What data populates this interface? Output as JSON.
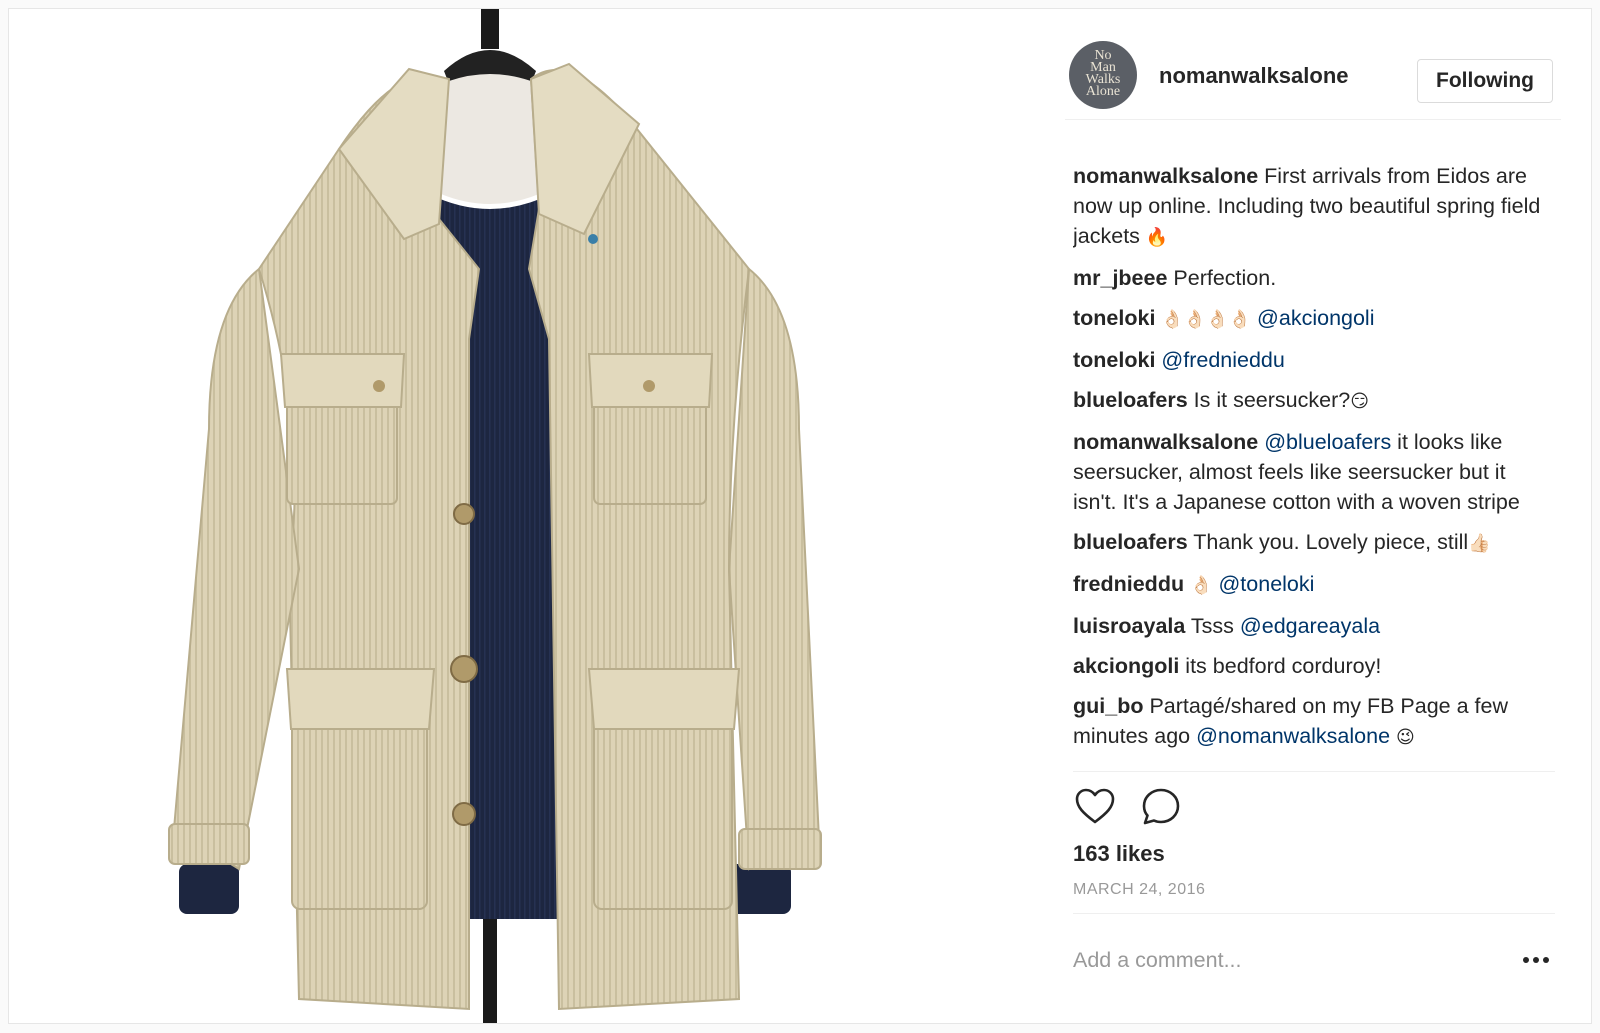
{
  "post": {
    "username": "nomanwalksalone",
    "follow_label": "Following",
    "avatar_logo_lines": [
      "No",
      "Man",
      "Walks",
      "Alone"
    ]
  },
  "comments": [
    {
      "user": "nomanwalksalone",
      "parts": [
        {
          "t": "text",
          "v": " First arrivals from Eidos are now up online. Including two beautiful spring field jackets "
        },
        {
          "t": "emoji",
          "v": "🔥"
        }
      ]
    },
    {
      "user": "mr_jbeee",
      "parts": [
        {
          "t": "text",
          "v": " Perfection."
        }
      ]
    },
    {
      "user": "toneloki",
      "parts": [
        {
          "t": "text",
          "v": " "
        },
        {
          "t": "emoji",
          "v": "👌🏻👌🏻👌🏻👌🏻"
        },
        {
          "t": "text",
          "v": " "
        },
        {
          "t": "mention",
          "v": "@akciongoli"
        }
      ]
    },
    {
      "user": "toneloki",
      "parts": [
        {
          "t": "text",
          "v": " "
        },
        {
          "t": "mention",
          "v": "@frednieddu"
        }
      ]
    },
    {
      "user": "blueloafers",
      "parts": [
        {
          "t": "text",
          "v": " Is it seersucker?"
        },
        {
          "t": "emoji",
          "v": "😏"
        }
      ]
    },
    {
      "user": "nomanwalksalone",
      "parts": [
        {
          "t": "text",
          "v": " "
        },
        {
          "t": "mention",
          "v": "@blueloafers"
        },
        {
          "t": "text",
          "v": " it looks like seersucker, almost feels like seersucker but it isn't. It's a Japanese cotton with a woven stripe"
        }
      ]
    },
    {
      "user": "blueloafers",
      "parts": [
        {
          "t": "text",
          "v": " Thank you. Lovely piece, still"
        },
        {
          "t": "emoji",
          "v": "👍🏻"
        }
      ]
    },
    {
      "user": "frednieddu",
      "parts": [
        {
          "t": "text",
          "v": " "
        },
        {
          "t": "emoji",
          "v": "👌🏻"
        },
        {
          "t": "text",
          "v": " "
        },
        {
          "t": "mention",
          "v": "@toneloki"
        }
      ]
    },
    {
      "user": "luisroayala",
      "parts": [
        {
          "t": "text",
          "v": " Tsss "
        },
        {
          "t": "mention",
          "v": "@edgareayala"
        }
      ]
    },
    {
      "user": "akciongoli",
      "parts": [
        {
          "t": "text",
          "v": " its bedford corduroy!"
        }
      ]
    },
    {
      "user": "gui_bo",
      "parts": [
        {
          "t": "text",
          "v": " Partagé/shared on my FB Page a few minutes ago "
        },
        {
          "t": "mention",
          "v": "@nomanwalksalone"
        },
        {
          "t": "text",
          "v": " "
        },
        {
          "t": "emoji",
          "v": "😉"
        }
      ]
    }
  ],
  "actions": {
    "like_icon": "heart-icon",
    "comment_icon": "speech-bubble-icon",
    "more_icon": "ellipsis-icon"
  },
  "likes_text": "163 likes",
  "date_text": "MARCH 24, 2016",
  "add_comment": {
    "placeholder": "Add a comment...",
    "value": ""
  },
  "colors": {
    "text": "#262626",
    "mention": "#003569",
    "muted": "#999999",
    "border": "#efefef"
  }
}
